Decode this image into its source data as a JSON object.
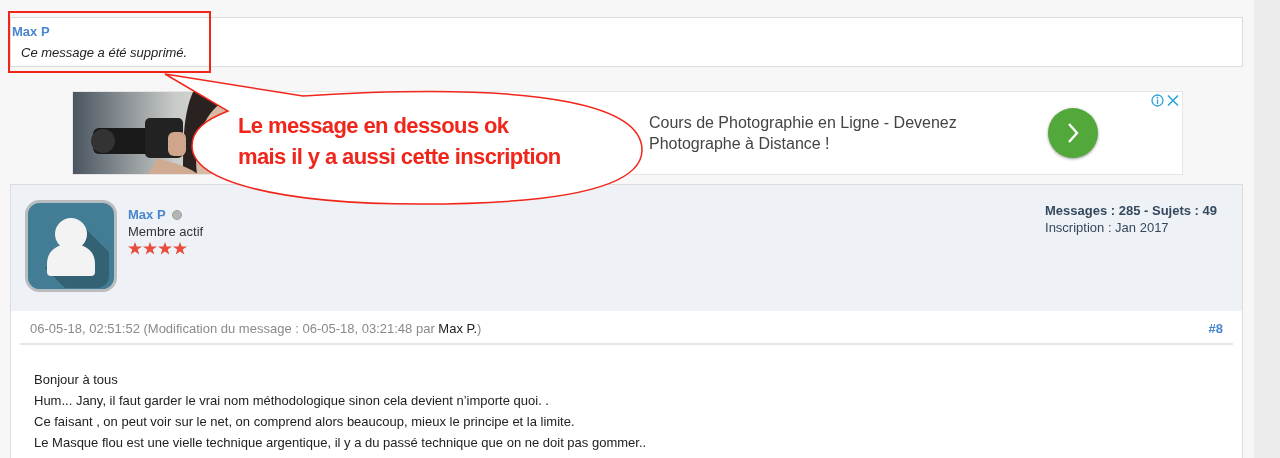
{
  "deleted_post": {
    "author": "Max P",
    "message": "Ce message a été supprimé."
  },
  "ad": {
    "kind": "picture",
    "headline": "Cours de Photographie en Ligne - Devenez Photographe à Distance !"
  },
  "post": {
    "author": "Max P",
    "online": false,
    "rank": "Membre actif",
    "stars": 4,
    "stats": "Messages : 285 - Sujets : 49",
    "inscription": "Inscription : Jan 2017",
    "meta_before": "06-05-18, 02:51:52 (Modification du message : 06-05-18, 03:21:48 par ",
    "editor": "Max P.",
    "meta_after": ")",
    "number": "#8",
    "body": [
      "Bonjour à tous",
      "Hum... Jany, il faut garder le vrai nom méthodologique sinon cela devient n’importe quoi. .",
      "Ce faisant , on peut voir  sur le net, on comprend alors beaucoup, mieux le principe et la limite.",
      "Le Masque flou est une vielle technique argentique, il y a du passé technique que on ne doit pas gommer.."
    ]
  },
  "annotation": {
    "lines": [
      "Le message en dessous ok",
      "mais il y a aussi cette inscription"
    ]
  }
}
